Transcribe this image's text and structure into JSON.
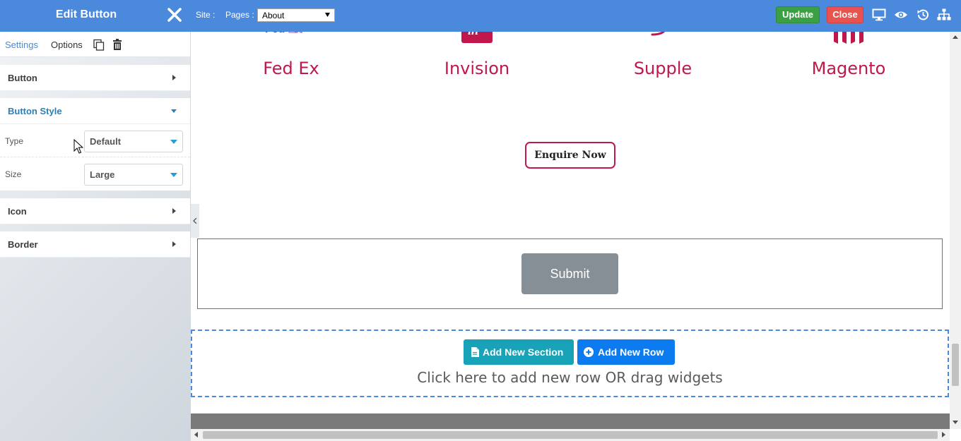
{
  "sidebar": {
    "title": "Edit Button",
    "tabs": [
      {
        "label": "Settings",
        "active": true
      },
      {
        "label": "Options",
        "active": false
      }
    ],
    "panels": {
      "button": {
        "label": "Button"
      },
      "button_style": {
        "label": "Button Style",
        "fields": [
          {
            "label": "Type",
            "value": "Default"
          },
          {
            "label": "Size",
            "value": "Large"
          }
        ]
      },
      "icon": {
        "label": "Icon"
      },
      "border": {
        "label": "Border"
      }
    }
  },
  "topbar": {
    "site_label": "Site :",
    "pages_label": "Pages :",
    "pages_selected": "About",
    "update_label": "Update",
    "close_label": "Close"
  },
  "canvas": {
    "brands": [
      {
        "name": "Fed Ex"
      },
      {
        "name": "Invision"
      },
      {
        "name": "Supple"
      },
      {
        "name": "Magento"
      }
    ],
    "enquire_label": "Enquire Now",
    "submit_label": "Submit",
    "add_section_label": "Add New Section",
    "add_row_label": "Add New Row",
    "add_hint": "Click here to add new row OR drag widgets"
  },
  "colors": {
    "primary": "#4a89dc",
    "brand_accent": "#c0184b",
    "update_green": "#3aa043",
    "close_red": "#e9534f",
    "add_section_teal": "#17a2b8",
    "add_row_blue": "#0d7bf0",
    "submit_gray": "#868e96"
  }
}
